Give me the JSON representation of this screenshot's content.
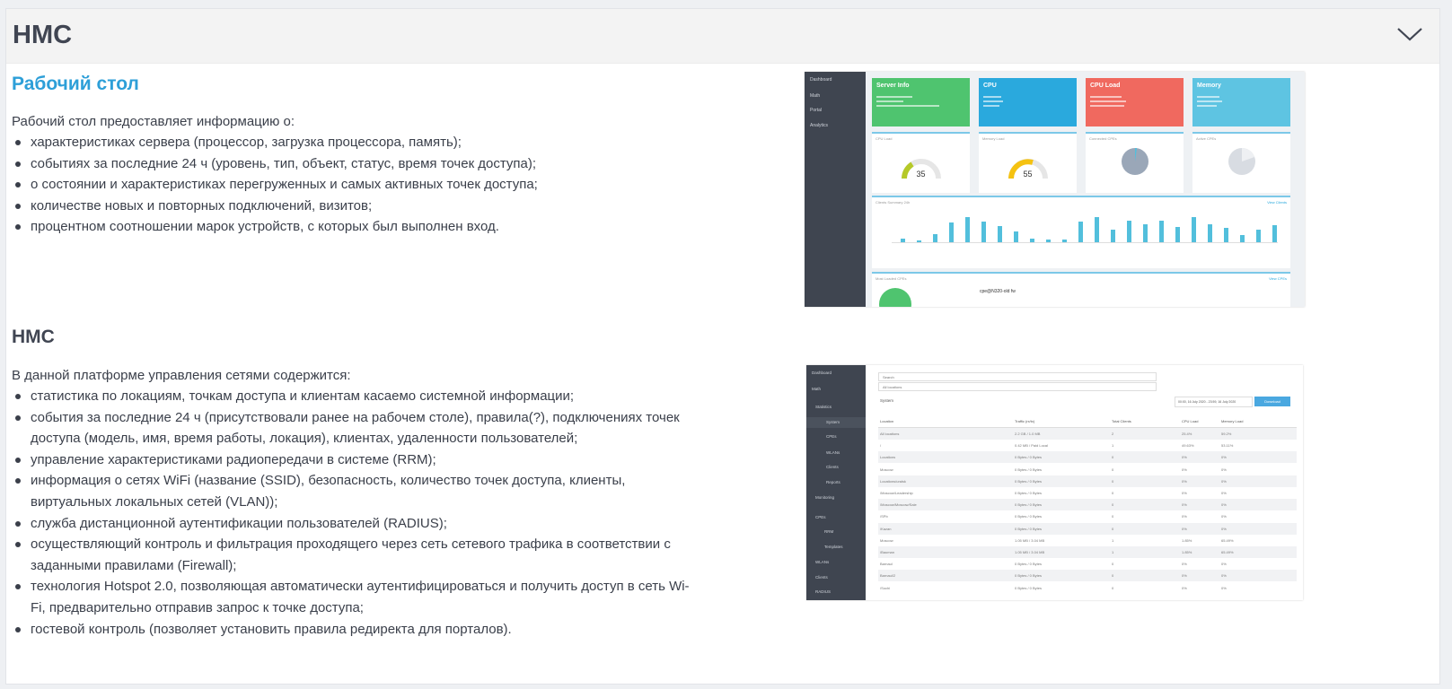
{
  "header": {
    "title": "HMC"
  },
  "desktop": {
    "heading": "Рабочий стол",
    "intro": "Рабочий стол предоставляет информацию о:",
    "bullets": [
      "характеристиках сервера (процессор, загрузка процессора, память);",
      "событиях за последние 24 ч (уровень, тип, объект, статус, время точек доступа);",
      "о состоянии и характеристиках перегруженных и самых активных точек доступа;",
      "количестве новых и повторных подключений, визитов;",
      "процентном соотношении марок устройств, с которых был выполнен вход."
    ]
  },
  "hmc": {
    "heading": "HMC",
    "intro": "В данной платформе управления сетями содержится:",
    "bullets": [
      "статистика по локациям, точкам доступа и клиентам касаемо системной информации;",
      "события за последние 24 ч (присутствовали ранее на рабочем столе), правила(?), подключениях точек доступа (модель, имя, время работы, локация), клиентах, удаленности пользователей;",
      "управление характеристиками радиопередачи в системе (RRM);",
      "информация о сетях WiFi (название (SSID), безопасность, количество точек доступа, клиенты, виртуальных локальных сетей (VLAN));",
      "служба дистанционной аутентификации пользователей (RADIUS);",
      "осуществляющий контроль и фильтрация проходящего через сеть сетевого трафика в соответствии с заданными правилами (Firewall);",
      "технология Hotspot 2.0, позволяющая автоматически аутентифицироваться и получить доступ в сеть Wi-Fi, предварительно отправив запрос к точке доступа;",
      "гостевой контроль (позволяет установить правила редиректа для порталов)."
    ]
  },
  "dashboard_shot": {
    "nav": [
      "Dashboard",
      "Math",
      "Portal",
      "Analytics"
    ],
    "tiles": [
      {
        "title": "Server Info",
        "color": "#4fc46f"
      },
      {
        "title": "CPU",
        "color": "#2aa9dd"
      },
      {
        "title": "CPU Load",
        "color": "#f0695f"
      },
      {
        "title": "Memory",
        "color": "#5ec4e2"
      }
    ],
    "panels": [
      "CPU Load",
      "Memory Load",
      "Connected CPEs",
      "Active CPEs"
    ],
    "gauge_values": [
      "35",
      "55"
    ],
    "clients_title": "Clients Summary 24h",
    "view_link": "View Clients",
    "loaded_title": "Most Loaded CPEs",
    "view_cpes": "View CPEs",
    "cpe_name": "cpe@N320-old fw"
  },
  "hmc_shot": {
    "nav": [
      "Dashboard",
      "Math",
      "Statistics",
      "System",
      "CPEs",
      "WLANs",
      "Clients",
      "Reports",
      "Monitoring",
      "CPEs",
      "RRM",
      "Templates",
      "WLANs",
      "Clients",
      "RADIUS"
    ],
    "search_placeholder": "Search",
    "location_placeholder": "All locations",
    "section_label": "System",
    "date_range": "00:00, 16 July 2020 - 23:59, 16 July 2020",
    "download": "Download",
    "columns": [
      "Location",
      "Traffic (rx/tx)",
      "Total Clients",
      "CPU Load",
      "Memory Load"
    ],
    "rows": [
      [
        "All locations",
        "2.2 GB / 1.0 MB",
        "2",
        "25.4%",
        "59.2%"
      ],
      [
        "/",
        "0.42 MB / Paid Local",
        "1",
        "49.63%",
        "53.11%"
      ],
      [
        "Locations",
        "0 Bytes / 0 Bytes",
        "0",
        "0%",
        "0%"
      ],
      [
        "Moscow",
        "0 Bytes / 0 Bytes",
        "0",
        "0%",
        "0%"
      ],
      [
        "Locations/uralsk",
        "0 Bytes / 0 Bytes",
        "0",
        "0%",
        "0%"
      ],
      [
        "/Moscow/Leadership",
        "0 Bytes / 0 Bytes",
        "0",
        "0%",
        "0%"
      ],
      [
        "/Moscow/Moscow/Sale",
        "0 Bytes / 0 Bytes",
        "0",
        "0%",
        "0%"
      ],
      [
        "/SPb",
        "0 Bytes / 0 Bytes",
        "0",
        "0%",
        "0%"
      ],
      [
        "/Kazan",
        "0 Bytes / 0 Bytes",
        "0",
        "0%",
        "0%"
      ],
      [
        "Moscow",
        "1.05 MB / 3.04 MB",
        "1",
        "1.85%",
        "65.49%"
      ],
      [
        "/Bauman",
        "1.05 MB / 3.04 MB",
        "1",
        "1.85%",
        "65.49%"
      ],
      [
        "Barnaul",
        "0 Bytes / 0 Bytes",
        "0",
        "0%",
        "0%"
      ],
      [
        "Barnaul/2",
        "0 Bytes / 0 Bytes",
        "0",
        "0%",
        "0%"
      ],
      [
        "/Sochi",
        "0 Bytes / 0 Bytes",
        "0",
        "0%",
        "0%"
      ]
    ]
  }
}
